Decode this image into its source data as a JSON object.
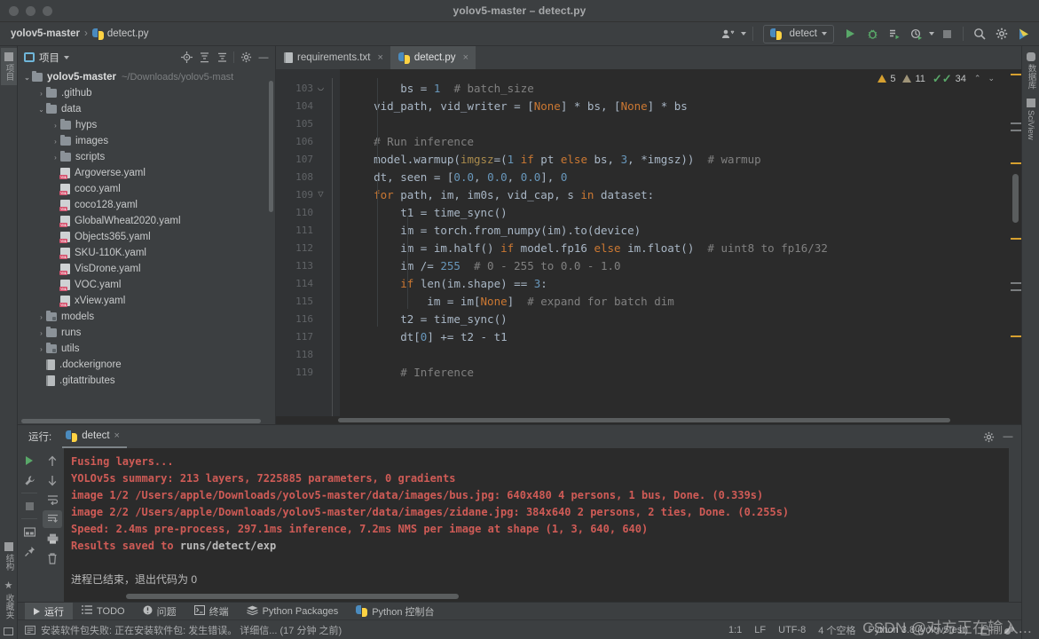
{
  "window": {
    "title": "yolov5-master – detect.py",
    "traffic_lights": [
      "close",
      "minimize",
      "zoom"
    ]
  },
  "breadcrumb": {
    "project": "yolov5-master",
    "separator": "›",
    "file": "detect.py"
  },
  "toolbar": {
    "run_config": "detect",
    "icons": [
      "user-group-icon",
      "run-icon",
      "debug-icon",
      "coverage-icon",
      "profile-icon",
      "stop-icon",
      "search-icon",
      "settings-icon",
      "updates-icon"
    ]
  },
  "left_strip": [
    {
      "label": "项目",
      "icon": "project-icon",
      "selected": true
    },
    {
      "label": "结构",
      "icon": "structure-icon",
      "selected": false
    },
    {
      "label": "收藏夹",
      "icon": "favorites-star-icon",
      "selected": false
    }
  ],
  "right_strip": [
    {
      "label": "数据库",
      "icon": "database-icon"
    },
    {
      "label": "SciView",
      "icon": "sciview-icon"
    }
  ],
  "project_panel": {
    "title": "项目",
    "header_icons": [
      "locate-icon",
      "expand-all-icon",
      "collapse-all-icon",
      "gear-icon",
      "hide-icon"
    ],
    "tree": [
      {
        "label": "yolov5-master",
        "note": "~/Downloads/yolov5-mast",
        "type": "root",
        "depth": 0,
        "arrow": "⌄"
      },
      {
        "label": ".github",
        "type": "folder",
        "depth": 1,
        "arrow": "›"
      },
      {
        "label": "data",
        "type": "folder",
        "depth": 1,
        "arrow": "⌄"
      },
      {
        "label": "hyps",
        "type": "folder",
        "depth": 2,
        "arrow": "›"
      },
      {
        "label": "images",
        "type": "folder",
        "depth": 2,
        "arrow": "›"
      },
      {
        "label": "scripts",
        "type": "folder",
        "depth": 2,
        "arrow": "›"
      },
      {
        "label": "Argoverse.yaml",
        "type": "yaml",
        "depth": 2,
        "arrow": ""
      },
      {
        "label": "coco.yaml",
        "type": "yaml",
        "depth": 2,
        "arrow": ""
      },
      {
        "label": "coco128.yaml",
        "type": "yaml",
        "depth": 2,
        "arrow": ""
      },
      {
        "label": "GlobalWheat2020.yaml",
        "type": "yaml",
        "depth": 2,
        "arrow": ""
      },
      {
        "label": "Objects365.yaml",
        "type": "yaml",
        "depth": 2,
        "arrow": ""
      },
      {
        "label": "SKU-110K.yaml",
        "type": "yaml",
        "depth": 2,
        "arrow": ""
      },
      {
        "label": "VisDrone.yaml",
        "type": "yaml",
        "depth": 2,
        "arrow": ""
      },
      {
        "label": "VOC.yaml",
        "type": "yaml",
        "depth": 2,
        "arrow": ""
      },
      {
        "label": "xView.yaml",
        "type": "yaml",
        "depth": 2,
        "arrow": ""
      },
      {
        "label": "models",
        "type": "folder-src",
        "depth": 1,
        "arrow": "›"
      },
      {
        "label": "runs",
        "type": "folder",
        "depth": 1,
        "arrow": "›"
      },
      {
        "label": "utils",
        "type": "folder-src",
        "depth": 1,
        "arrow": "›"
      },
      {
        "label": ".dockerignore",
        "type": "file",
        "depth": 1,
        "arrow": ""
      },
      {
        "label": ".gitattributes",
        "type": "file",
        "depth": 1,
        "arrow": ""
      }
    ]
  },
  "editor": {
    "tabs": [
      {
        "label": "requirements.txt",
        "icon": "text-file-icon",
        "active": false,
        "close": "×"
      },
      {
        "label": "detect.py",
        "icon": "python-file-icon",
        "active": true,
        "close": "×"
      }
    ],
    "inspection": {
      "warnings": "5",
      "weak_warnings": "11",
      "typos": "34",
      "up": "⌃",
      "down": "⌄"
    },
    "line_numbers": [
      "103",
      "104",
      "105",
      "106",
      "107",
      "108",
      "109",
      "110",
      "111",
      "112",
      "113",
      "114",
      "115",
      "116",
      "117",
      "118",
      "119"
    ],
    "code_lines": [
      {
        "n": "",
        "html": ""
      },
      {
        "n": "103",
        "html": "        <span class=\"fn\">bs</span> = <span class=\"num\">1</span>  <span class=\"cm\"># batch_size</span>"
      },
      {
        "n": "104",
        "html": "    vid_path, vid_writer = [<span class=\"kw\">None</span>] * bs, [<span class=\"kw\">None</span>] * bs"
      },
      {
        "n": "105",
        "html": ""
      },
      {
        "n": "106",
        "html": "    <span class=\"cm\"># Run inference</span>"
      },
      {
        "n": "107",
        "html": "    model.warmup(<span class=\"named\">imgsz</span>=(<span class=\"num\">1</span> <span class=\"kw\">if</span> pt <span class=\"kw\">else</span> bs, <span class=\"num\">3</span>, *imgsz))  <span class=\"cm\"># warmup</span>"
      },
      {
        "n": "108",
        "html": "    dt, seen = [<span class=\"num\">0.0</span>, <span class=\"num\">0.0</span>, <span class=\"num\">0.0</span>], <span class=\"num\">0</span>"
      },
      {
        "n": "109",
        "html": "    <span class=\"kw\">for</span> path, im, im0s, vid_cap, s <span class=\"kw\">in</span> dataset:"
      },
      {
        "n": "110",
        "html": "        t1 = time_sync()"
      },
      {
        "n": "111",
        "html": "        im = torch.from_numpy(im).to(device)"
      },
      {
        "n": "112",
        "html": "        im = im.half() <span class=\"kw\">if</span> model.fp16 <span class=\"kw\">else</span> im.float()  <span class=\"cm\"># uint8 to fp16/32</span>"
      },
      {
        "n": "113",
        "html": "        im /= <span class=\"num\">255</span>  <span class=\"cm\"># 0 - 255 to 0.0 - 1.0</span>"
      },
      {
        "n": "114",
        "html": "        <span class=\"kw\">if</span> <span class=\"fn\">len</span>(im.shape) == <span class=\"num\">3</span>:"
      },
      {
        "n": "115",
        "html": "            im = im[<span class=\"kw\">None</span>]  <span class=\"cm\"># expand for batch dim</span>"
      },
      {
        "n": "116",
        "html": "        t2 = time_sync()"
      },
      {
        "n": "117",
        "html": "        dt[<span class=\"num\">0</span>] += t2 - t1"
      },
      {
        "n": "118",
        "html": ""
      },
      {
        "n": "119",
        "html": "        <span class=\"cm\"># Inference</span>"
      }
    ]
  },
  "run_panel": {
    "label": "运行:",
    "tab": "detect",
    "tab_close": "×",
    "header_icons": [
      "gear-icon",
      "hide-icon"
    ],
    "side_icons_left": [
      "rerun-icon",
      "wrench-icon",
      "stop-icon",
      "layout-icon",
      "pin-icon"
    ],
    "side_icons_right": [
      "up-icon",
      "down-icon",
      "soft-wrap-icon",
      "scroll-to-end-icon",
      "print-icon",
      "trash-icon"
    ],
    "output": [
      {
        "text": "Fusing layers...",
        "style": "red-bold"
      },
      {
        "text": "YOLOv5s summary: 213 layers, 7225885 parameters, 0 gradients",
        "style": "red-bold"
      },
      {
        "text": "image 1/2 /Users/apple/Downloads/yolov5-master/data/images/bus.jpg: 640x480 4 persons, 1 bus, Done. (0.339s)",
        "style": "red-bold"
      },
      {
        "text": "image 2/2 /Users/apple/Downloads/yolov5-master/data/images/zidane.jpg: 384x640 2 persons, 2 ties, Done. (0.255s)",
        "style": "red-bold"
      },
      {
        "text": "Speed: 2.4ms pre-process, 297.1ms inference, 7.2ms NMS per image at shape (1, 3, 640, 640)",
        "style": "red-bold"
      },
      {
        "text": "Results saved to runs/detect/exp",
        "style": "red-mixed",
        "prefix": "Results saved to ",
        "suffix": "runs/detect/exp"
      },
      {
        "text": "",
        "style": "blank"
      },
      {
        "text": "进程已结束，退出代码为 0",
        "style": "white"
      }
    ]
  },
  "bottom_tools": [
    {
      "label": "运行",
      "icon": "run-triangle-icon",
      "selected": true
    },
    {
      "label": "TODO",
      "icon": "todo-list-icon",
      "selected": false
    },
    {
      "label": "问题",
      "icon": "problems-icon",
      "selected": false
    },
    {
      "label": "终端",
      "icon": "terminal-icon",
      "selected": false
    },
    {
      "label": "Python Packages",
      "icon": "packages-icon",
      "selected": false
    },
    {
      "label": "Python 控制台",
      "icon": "python-console-icon",
      "selected": false
    }
  ],
  "status_bar": {
    "message": "安装软件包失败: 正在安装软件包: 发生错误。 详细信... (17 分钟 之前)",
    "message_icon": "notification-icon",
    "caret": "1:1",
    "line_sep": "LF",
    "encoding": "UTF-8",
    "indent": "4 个空格",
    "interpreter": "Python 3.8 (yolov5test)",
    "right_icons": [
      "lock-icon",
      "memory-icon"
    ]
  },
  "watermark": "CSDN @对方正在输入...",
  "colors": {
    "chrome": "#3c3f41",
    "editor_bg": "#2b2b2b",
    "accent_green": "#59a869",
    "console_red": "#cf5b56",
    "keyword_orange": "#cc7832",
    "number_blue": "#6897bb",
    "comment_grey": "#808080"
  }
}
